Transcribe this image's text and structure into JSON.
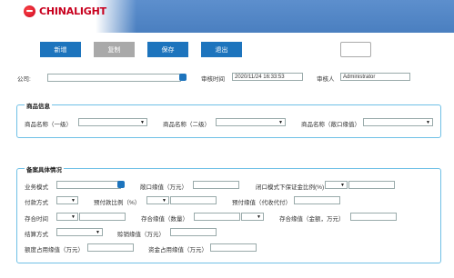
{
  "header": {
    "logo_text": "CHINALIGHT"
  },
  "toolbar": {
    "add_label": "新增",
    "copy_label": "复制",
    "save_label": "保存",
    "exit_label": "退出"
  },
  "form": {
    "company_label": "公司:",
    "company_value": "",
    "review_time_label": "审核时间",
    "review_time_value": "2020/11/24 16:33:53",
    "reviewer_label": "审核人",
    "reviewer_value": "Administrator"
  },
  "product_info": {
    "title": "商品信息",
    "level1_label": "商品名称（一级）",
    "level2_label": "商品名称（二级）",
    "import_limit_label": "商品名称（敞口缘值）"
  },
  "filing": {
    "title": "备案具体情况",
    "business_mode_label": "业务模式",
    "exposure_limit_label": "敞口缘值（万元）",
    "closed_deposit_label": "闭口模式下保证金比例(%)",
    "payment_method_label": "付款方式",
    "advance_ratio_label": "预付款比例（%）",
    "advance_limit_label": "预付缘值（代收代付）",
    "storage_time_label": "存合时间",
    "storage_qty_label": "存合缘值（数量）",
    "storage_amount_label": "存合缘值（金额，万元）",
    "settlement_label": "结算方式",
    "sales_limit_label": "赊销缘值（万元）",
    "credit_quota_label": "额度占用缘值（万元）",
    "capital_quota_label": "资金占用缘值（万元）"
  },
  "icons": {
    "dropdown": "chevron-down-icon",
    "picker": "lookup-picker-icon"
  },
  "colors": {
    "header_bar": "#4a7fc0",
    "button": "#1d74bd",
    "disabled_button": "#a9a9a9",
    "section_border": "#6fc0e6",
    "logo": "#c8001e"
  }
}
